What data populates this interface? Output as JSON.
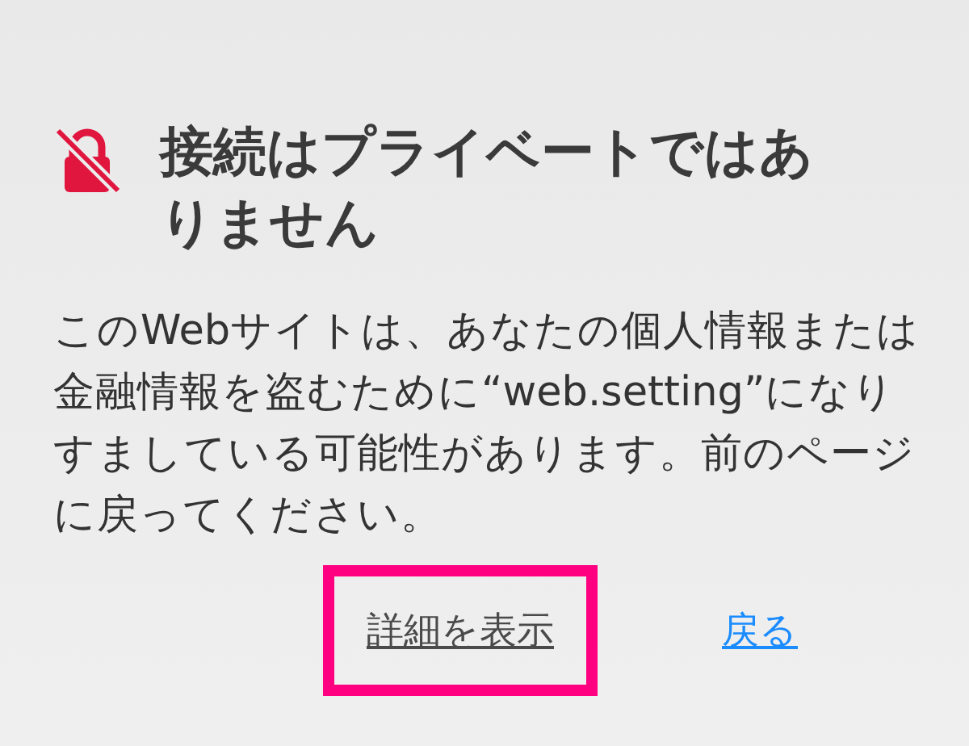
{
  "title": "接続はプライベートではありません",
  "message": "このWebサイトは、あなたの個人情報または金融情報を盗むために“web.setting”になりすましている可能性があります。前のページに戻ってください。",
  "links": [
    {
      "label": "詳細を表示",
      "kind": "details",
      "highlighted": true
    },
    {
      "label": "戻る",
      "kind": "back",
      "highlighted": false
    }
  ]
}
